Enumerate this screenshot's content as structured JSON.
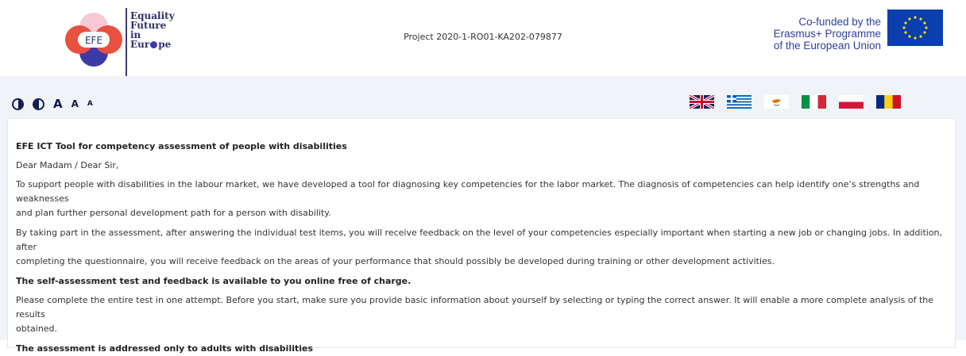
{
  "header": {
    "logo": {
      "mark_text": "EFE",
      "lines": [
        "Equality",
        "Future",
        "in",
        "Eur",
        "pe"
      ]
    },
    "project": "Project 2020-1-RO01-KA202-079877",
    "eu": {
      "lines": [
        "Co-funded by the",
        "Erasmus+ Programme",
        "of the European Union"
      ],
      "flag_color": "#0b3fae"
    }
  },
  "toolbar": {
    "font_large": "A",
    "font_medium": "A",
    "font_small": "A",
    "languages": [
      "English",
      "Greek",
      "Cypriot",
      "Italian",
      "Polish",
      "Romanian"
    ]
  },
  "content": {
    "title": "EFE ICT Tool for competency assessment of people with disabilities",
    "greeting": "Dear Madam / Dear Sir,",
    "p1_a": "To support people with disabilities in the labour market, we have developed a tool for diagnosing key competencies for the labor market. The diagnosis of competencies can help identify one’s strengths and weaknesses",
    "p1_b": "and plan further personal development path for a person with disability.",
    "p2_a": "By taking part in the assessment, after answering the individual test items, you will receive feedback on the level of your competencies especially important when starting a new job or changing jobs. In addition, after",
    "p2_b": "completing the questionnaire, you will receive feedback on the areas of your performance that should possibly be developed during training or other development activities.",
    "free": "The self-assessment test and feedback is available to you online free of charge.",
    "p3_a": "Please complete the entire test in one attempt. Before you start, make sure you provide basic information about yourself by selecting or typing the correct answer. It will enable a more complete analysis of the results",
    "p3_b": "obtained.",
    "adults": "The assessment is addressed only to adults with disabilities"
  },
  "colors": {
    "band": "#f0f3f8",
    "navy": "#0d1a4f",
    "eu_blue": "#2c3ea0"
  }
}
